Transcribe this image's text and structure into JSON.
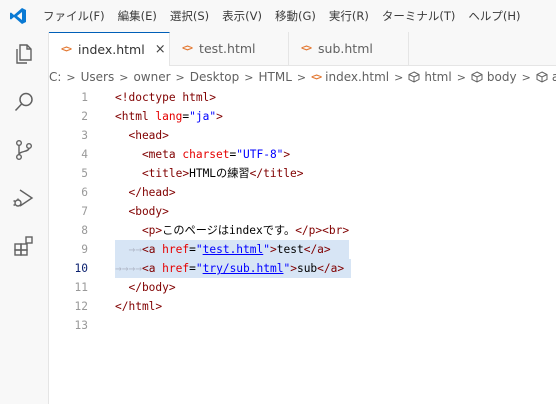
{
  "menu": [
    "ファイル(F)",
    "編集(E)",
    "選択(S)",
    "表示(V)",
    "移動(G)",
    "実行(R)",
    "ターミナル(T)",
    "ヘルプ(H)"
  ],
  "tabs": [
    {
      "label": "index.html",
      "active": true,
      "close": "×"
    },
    {
      "label": "test.html",
      "active": false
    },
    {
      "label": "sub.html",
      "active": false
    }
  ],
  "tab_icon_text": "<>",
  "breadcrumb": {
    "items": [
      "C:",
      "Users",
      "owner",
      "Desktop",
      "HTML",
      "index.html",
      "html",
      "body",
      "a"
    ],
    "separator": ">"
  },
  "editor": {
    "current_line": 10,
    "lines": [
      {
        "n": "1",
        "t": [
          [
            "t",
            "<!doctype html>"
          ]
        ]
      },
      {
        "n": "2",
        "t": [
          [
            "t",
            "<html "
          ],
          [
            "a",
            "lang"
          ],
          [
            "x",
            "="
          ],
          [
            "v",
            "\"ja\""
          ],
          [
            "t",
            ">"
          ]
        ]
      },
      {
        "n": "3",
        "t": [
          [
            "t",
            "  <head>"
          ]
        ]
      },
      {
        "n": "4",
        "t": [
          [
            "t",
            "    <meta "
          ],
          [
            "a",
            "charset"
          ],
          [
            "x",
            "="
          ],
          [
            "v",
            "\"UTF-8\""
          ],
          [
            "t",
            ">"
          ]
        ]
      },
      {
        "n": "5",
        "t": [
          [
            "t",
            "    <title>"
          ],
          [
            "x",
            "HTMLの練習"
          ],
          [
            "t",
            "</title>"
          ]
        ]
      },
      {
        "n": "6",
        "t": [
          [
            "t",
            "  </head>"
          ]
        ]
      },
      {
        "n": "7",
        "t": [
          [
            "t",
            "  <body>"
          ]
        ]
      },
      {
        "n": "8",
        "t": [
          [
            "t",
            "    <p>"
          ],
          [
            "x",
            "このページはindexです。"
          ],
          [
            "t",
            "</p><br>"
          ]
        ]
      },
      {
        "n": "9",
        "t": [
          [
            "w",
            "  →→"
          ],
          [
            "t",
            "<a "
          ],
          [
            "a",
            "href"
          ],
          [
            "x",
            "="
          ],
          [
            "v",
            "\""
          ],
          [
            "l",
            "test.html"
          ],
          [
            "v",
            "\""
          ],
          [
            "t",
            ">"
          ],
          [
            "x",
            "test"
          ],
          [
            "t",
            "</a>"
          ]
        ],
        "sel": true
      },
      {
        "n": "10",
        "t": [
          [
            "w",
            "→→→→"
          ],
          [
            "t",
            "<a "
          ],
          [
            "a",
            "href"
          ],
          [
            "x",
            "="
          ],
          [
            "v",
            "\""
          ],
          [
            "l",
            "try/sub.html"
          ],
          [
            "v",
            "\""
          ],
          [
            "t",
            ">"
          ],
          [
            "x",
            "sub"
          ],
          [
            "t",
            "</a>"
          ]
        ],
        "sel": true
      },
      {
        "n": "11",
        "t": [
          [
            "t",
            "  </body>"
          ]
        ]
      },
      {
        "n": "12",
        "t": [
          [
            "t",
            "</html>"
          ]
        ]
      },
      {
        "n": "13",
        "t": []
      }
    ]
  },
  "colors": {
    "tag": "#800000",
    "attribute": "#e50000",
    "value": "#0000ff",
    "text": "#000000",
    "selection": "#d7e5f5",
    "accent": "#005fb8",
    "html_icon": "#e37933"
  },
  "activity_icons": [
    "explorer-icon",
    "search-icon",
    "source-control-icon",
    "run-debug-icon",
    "extensions-icon"
  ]
}
